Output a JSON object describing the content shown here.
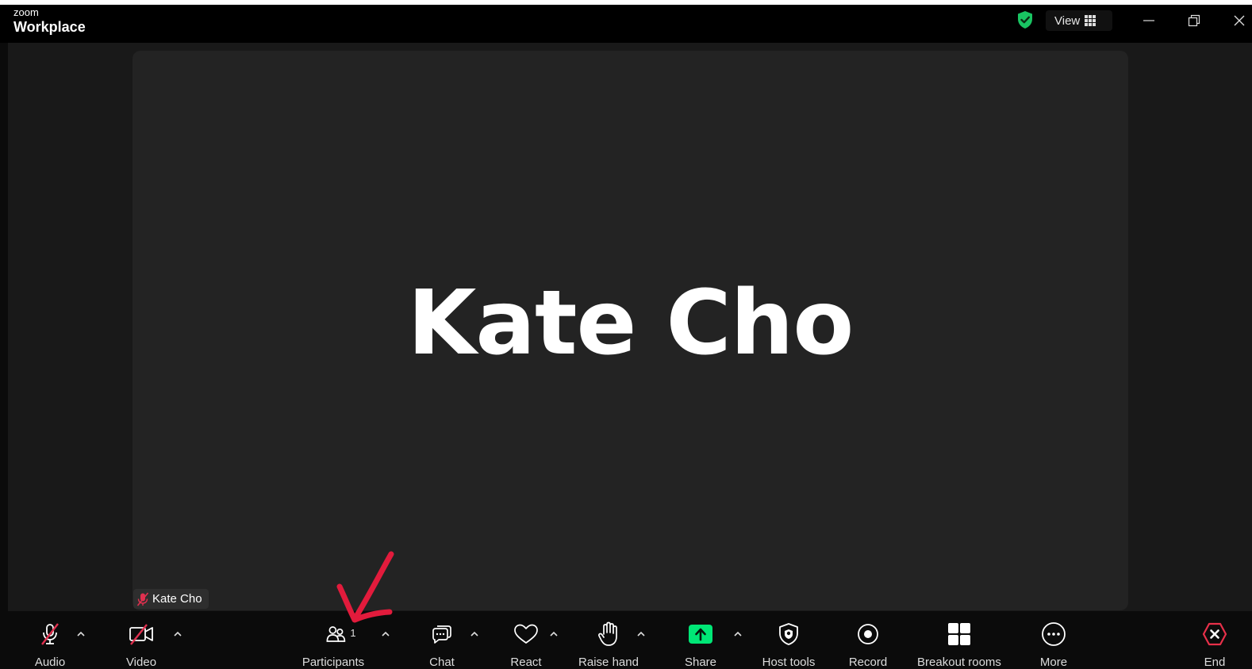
{
  "titlebar": {
    "brand_top": "zoom",
    "brand_bottom": "Workplace",
    "view_label": "View",
    "icons": [
      "shield-check-icon",
      "grid-icon",
      "minimize-icon",
      "restore-icon",
      "close-icon"
    ]
  },
  "colors": {
    "accent_green": "#19c462",
    "share_green": "#00e676",
    "muted_red": "#e0304f",
    "annotation_red": "#e21b3c",
    "end_red": "#e8304a"
  },
  "video": {
    "participant_display_name": "Kate Cho",
    "name_tag": "Kate Cho"
  },
  "toolbar": {
    "audio": "Audio",
    "video": "Video",
    "participants": "Participants",
    "participants_count": "1",
    "chat": "Chat",
    "react": "React",
    "raise_hand": "Raise hand",
    "share": "Share",
    "host_tools": "Host tools",
    "record": "Record",
    "breakout_rooms": "Breakout rooms",
    "more": "More",
    "end": "End"
  }
}
